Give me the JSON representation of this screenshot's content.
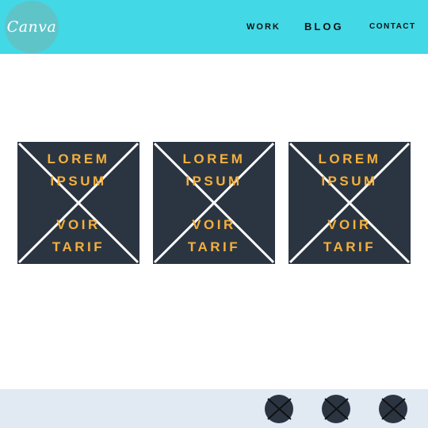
{
  "colors": {
    "header_bg": "#42d8e6",
    "logo_bg": "#5fc4c8",
    "card_bg": "#2b3542",
    "card_text": "#f5b03c",
    "footer_bg": "#e1e9f3",
    "social_bg": "#2b3542"
  },
  "header": {
    "logo_text": "Canva",
    "nav": [
      {
        "label": "WORK"
      },
      {
        "label": "BLOG"
      },
      {
        "label": "CONTACT"
      }
    ]
  },
  "cards": [
    {
      "line1": "LOREM",
      "line2": "IPSUM",
      "line3": "VOIR",
      "line4": "TARIF"
    },
    {
      "line1": "LOREM",
      "line2": "IPSUM",
      "line3": "VOIR",
      "line4": "TARIF"
    },
    {
      "line1": "LOREM",
      "line2": "IPSUM",
      "line3": "VOIR",
      "line4": "TARIF"
    }
  ],
  "footer": {
    "social_icons": [
      "placeholder-icon",
      "placeholder-icon",
      "placeholder-icon"
    ]
  }
}
